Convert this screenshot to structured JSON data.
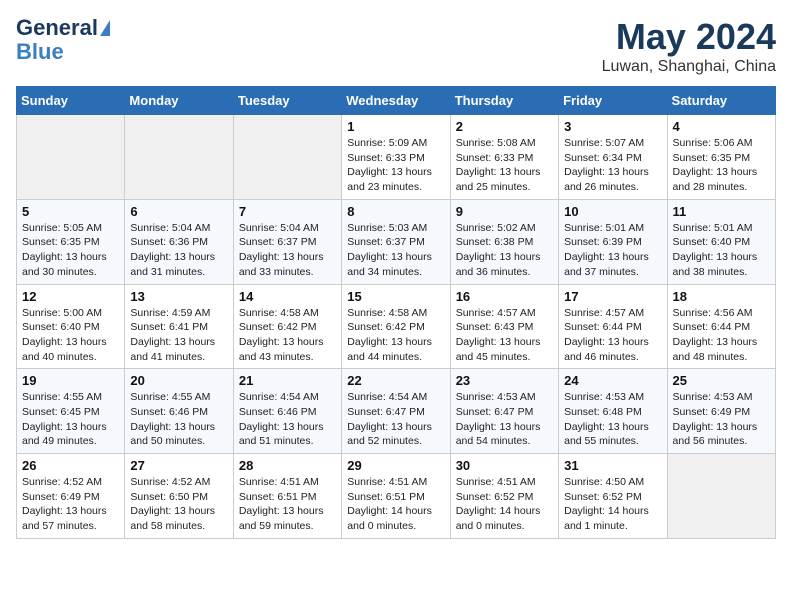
{
  "header": {
    "logo_line1": "General",
    "logo_line2": "Blue",
    "title": "May 2024",
    "subtitle": "Luwan, Shanghai, China"
  },
  "days_of_week": [
    "Sunday",
    "Monday",
    "Tuesday",
    "Wednesday",
    "Thursday",
    "Friday",
    "Saturday"
  ],
  "weeks": [
    [
      {
        "day": "",
        "empty": true
      },
      {
        "day": "",
        "empty": true
      },
      {
        "day": "",
        "empty": true
      },
      {
        "day": "1",
        "sunrise": "5:09 AM",
        "sunset": "6:33 PM",
        "daylight": "13 hours and 23 minutes."
      },
      {
        "day": "2",
        "sunrise": "5:08 AM",
        "sunset": "6:33 PM",
        "daylight": "13 hours and 25 minutes."
      },
      {
        "day": "3",
        "sunrise": "5:07 AM",
        "sunset": "6:34 PM",
        "daylight": "13 hours and 26 minutes."
      },
      {
        "day": "4",
        "sunrise": "5:06 AM",
        "sunset": "6:35 PM",
        "daylight": "13 hours and 28 minutes."
      }
    ],
    [
      {
        "day": "5",
        "sunrise": "5:05 AM",
        "sunset": "6:35 PM",
        "daylight": "13 hours and 30 minutes."
      },
      {
        "day": "6",
        "sunrise": "5:04 AM",
        "sunset": "6:36 PM",
        "daylight": "13 hours and 31 minutes."
      },
      {
        "day": "7",
        "sunrise": "5:04 AM",
        "sunset": "6:37 PM",
        "daylight": "13 hours and 33 minutes."
      },
      {
        "day": "8",
        "sunrise": "5:03 AM",
        "sunset": "6:37 PM",
        "daylight": "13 hours and 34 minutes."
      },
      {
        "day": "9",
        "sunrise": "5:02 AM",
        "sunset": "6:38 PM",
        "daylight": "13 hours and 36 minutes."
      },
      {
        "day": "10",
        "sunrise": "5:01 AM",
        "sunset": "6:39 PM",
        "daylight": "13 hours and 37 minutes."
      },
      {
        "day": "11",
        "sunrise": "5:01 AM",
        "sunset": "6:40 PM",
        "daylight": "13 hours and 38 minutes."
      }
    ],
    [
      {
        "day": "12",
        "sunrise": "5:00 AM",
        "sunset": "6:40 PM",
        "daylight": "13 hours and 40 minutes."
      },
      {
        "day": "13",
        "sunrise": "4:59 AM",
        "sunset": "6:41 PM",
        "daylight": "13 hours and 41 minutes."
      },
      {
        "day": "14",
        "sunrise": "4:58 AM",
        "sunset": "6:42 PM",
        "daylight": "13 hours and 43 minutes."
      },
      {
        "day": "15",
        "sunrise": "4:58 AM",
        "sunset": "6:42 PM",
        "daylight": "13 hours and 44 minutes."
      },
      {
        "day": "16",
        "sunrise": "4:57 AM",
        "sunset": "6:43 PM",
        "daylight": "13 hours and 45 minutes."
      },
      {
        "day": "17",
        "sunrise": "4:57 AM",
        "sunset": "6:44 PM",
        "daylight": "13 hours and 46 minutes."
      },
      {
        "day": "18",
        "sunrise": "4:56 AM",
        "sunset": "6:44 PM",
        "daylight": "13 hours and 48 minutes."
      }
    ],
    [
      {
        "day": "19",
        "sunrise": "4:55 AM",
        "sunset": "6:45 PM",
        "daylight": "13 hours and 49 minutes."
      },
      {
        "day": "20",
        "sunrise": "4:55 AM",
        "sunset": "6:46 PM",
        "daylight": "13 hours and 50 minutes."
      },
      {
        "day": "21",
        "sunrise": "4:54 AM",
        "sunset": "6:46 PM",
        "daylight": "13 hours and 51 minutes."
      },
      {
        "day": "22",
        "sunrise": "4:54 AM",
        "sunset": "6:47 PM",
        "daylight": "13 hours and 52 minutes."
      },
      {
        "day": "23",
        "sunrise": "4:53 AM",
        "sunset": "6:47 PM",
        "daylight": "13 hours and 54 minutes."
      },
      {
        "day": "24",
        "sunrise": "4:53 AM",
        "sunset": "6:48 PM",
        "daylight": "13 hours and 55 minutes."
      },
      {
        "day": "25",
        "sunrise": "4:53 AM",
        "sunset": "6:49 PM",
        "daylight": "13 hours and 56 minutes."
      }
    ],
    [
      {
        "day": "26",
        "sunrise": "4:52 AM",
        "sunset": "6:49 PM",
        "daylight": "13 hours and 57 minutes."
      },
      {
        "day": "27",
        "sunrise": "4:52 AM",
        "sunset": "6:50 PM",
        "daylight": "13 hours and 58 minutes."
      },
      {
        "day": "28",
        "sunrise": "4:51 AM",
        "sunset": "6:51 PM",
        "daylight": "13 hours and 59 minutes."
      },
      {
        "day": "29",
        "sunrise": "4:51 AM",
        "sunset": "6:51 PM",
        "daylight": "14 hours and 0 minutes."
      },
      {
        "day": "30",
        "sunrise": "4:51 AM",
        "sunset": "6:52 PM",
        "daylight": "14 hours and 0 minutes."
      },
      {
        "day": "31",
        "sunrise": "4:50 AM",
        "sunset": "6:52 PM",
        "daylight": "14 hours and 1 minute."
      },
      {
        "day": "",
        "empty": true
      }
    ]
  ]
}
